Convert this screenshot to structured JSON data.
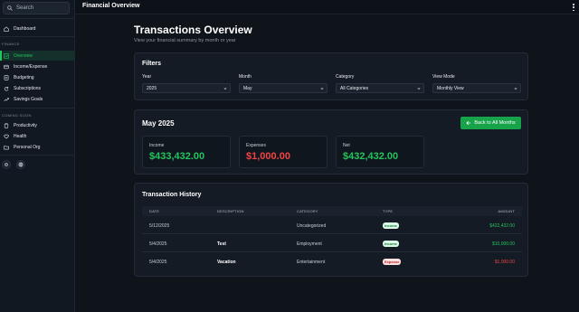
{
  "sidebar": {
    "search_placeholder": "Search",
    "dashboard": "Dashboard",
    "finance_label": "FINANCE",
    "finance_items": [
      "Overview",
      "Income/Expense",
      "Budgeting",
      "Subscriptions",
      "Savings Goals"
    ],
    "coming_soon_label": "COMING SOON",
    "coming_items": [
      "Productivity",
      "Health",
      "Personal Org"
    ]
  },
  "topbar": {
    "title": "Financial Overview"
  },
  "header": {
    "title": "Transactions Overview",
    "subtitle": "View your financial summary by month or year"
  },
  "filters": {
    "title": "Filters",
    "year": {
      "label": "Year",
      "value": "2025"
    },
    "month": {
      "label": "Month",
      "value": "May"
    },
    "category": {
      "label": "Category",
      "value": "All Categories"
    },
    "view_mode": {
      "label": "View Mode",
      "value": "Monthly View"
    }
  },
  "summary": {
    "title": "May 2025",
    "back_button": "Back to All Months",
    "income": {
      "label": "Income",
      "value": "$433,432.00"
    },
    "expenses": {
      "label": "Expenses",
      "value": "$1,000.00"
    },
    "net": {
      "label": "Net",
      "value": "$432,432.00"
    }
  },
  "history": {
    "title": "Transaction History",
    "columns": [
      "DATE",
      "DESCRIPTION",
      "CATEGORY",
      "TYPE",
      "AMOUNT"
    ],
    "rows": [
      {
        "date": "5/12/2025",
        "description": "",
        "category": "Uncategorized",
        "type": "Income",
        "amount": "$422,432.00"
      },
      {
        "date": "5/4/2025",
        "description": "Test",
        "category": "Employment",
        "type": "Income",
        "amount": "$10,000.00"
      },
      {
        "date": "5/4/2025",
        "description": "Vacation",
        "category": "Entertainment",
        "type": "Expense",
        "amount": "$1,000.00"
      }
    ]
  },
  "colors": {
    "accent": "#22c55e",
    "income": "#22c55e",
    "expense": "#ef4444",
    "background": "#0f141b",
    "card": "#141b24"
  }
}
